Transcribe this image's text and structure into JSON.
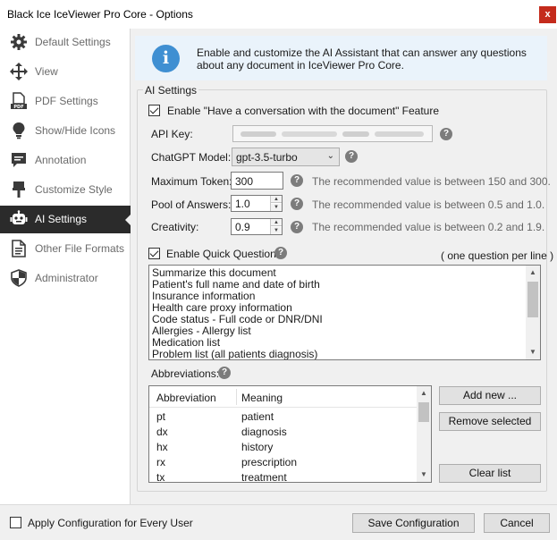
{
  "window": {
    "title": "Black Ice IceViewer Pro Core - Options",
    "close_glyph": "x"
  },
  "sidebar": {
    "items": [
      {
        "label": "Default Settings",
        "icon": "gear-icon"
      },
      {
        "label": "View",
        "icon": "move-arrows-icon"
      },
      {
        "label": "PDF Settings",
        "icon": "pdf-file-icon"
      },
      {
        "label": "Show/Hide Icons",
        "icon": "lightbulb-icon"
      },
      {
        "label": "Annotation",
        "icon": "speech-bubble-icon"
      },
      {
        "label": "Customize Style",
        "icon": "paintbrush-icon"
      },
      {
        "label": "AI Settings",
        "icon": "robot-icon",
        "active": true
      },
      {
        "label": "Other File Formats",
        "icon": "document-icon"
      },
      {
        "label": "Administrator",
        "icon": "shield-icon"
      }
    ]
  },
  "info": {
    "icon_glyph": "i",
    "line1": "Enable and customize the AI Assistant that can answer any questions",
    "line2": "about any document in IceViewer Pro Core."
  },
  "ai_settings": {
    "group_title": "AI Settings",
    "enable_conversation_label": "Enable \"Have a conversation with the document\" Feature",
    "enable_conversation_checked": true,
    "api_key_label": "API Key:",
    "help_glyph": "?",
    "chatgpt_model_label": "ChatGPT Model:",
    "chatgpt_model_value": "gpt-3.5-turbo",
    "max_token_label": "Maximum Token:",
    "max_token_value": "300",
    "max_token_hint": "The recommended value is between 150 and 300.",
    "pool_label": "Pool of Answers:",
    "pool_value": "1.0",
    "pool_hint": "The recommended value is between 0.5 and 1.0.",
    "creativity_label": "Creativity:",
    "creativity_value": "0.9",
    "creativity_hint": "The recommended value is between 0.2 and 1.9.",
    "quick_questions_label": "Enable Quick Questions",
    "quick_questions_checked": true,
    "quick_questions_note": "( one question per line )",
    "questions": [
      "Summarize this document",
      "Patient's full name and date of birth",
      "Insurance information",
      "Health care proxy information",
      "Code status - Full code or DNR/DNI",
      "Allergies - Allergy list",
      "Medication list",
      "Problem list (all patients diagnosis)"
    ],
    "abbreviations_label": "Abbreviations:",
    "abbr_columns": [
      "Abbreviation",
      "Meaning"
    ],
    "abbreviations": [
      {
        "abbr": "pt",
        "meaning": "patient"
      },
      {
        "abbr": "dx",
        "meaning": "diagnosis"
      },
      {
        "abbr": "hx",
        "meaning": "history"
      },
      {
        "abbr": "rx",
        "meaning": "prescription"
      },
      {
        "abbr": "tx",
        "meaning": "treatment"
      }
    ],
    "add_new_label": "Add new ...",
    "remove_selected_label": "Remove selected",
    "clear_list_label": "Clear list"
  },
  "footer": {
    "apply_all_users_label": "Apply Configuration for Every User",
    "apply_all_users_checked": false,
    "save_label": "Save Configuration",
    "cancel_label": "Cancel"
  },
  "colors": {
    "active_nav_bg": "#2b2b2b",
    "info_bg": "#eaf3fb",
    "info_icon": "#3f8fd2",
    "close_button": "#c42b1c"
  }
}
